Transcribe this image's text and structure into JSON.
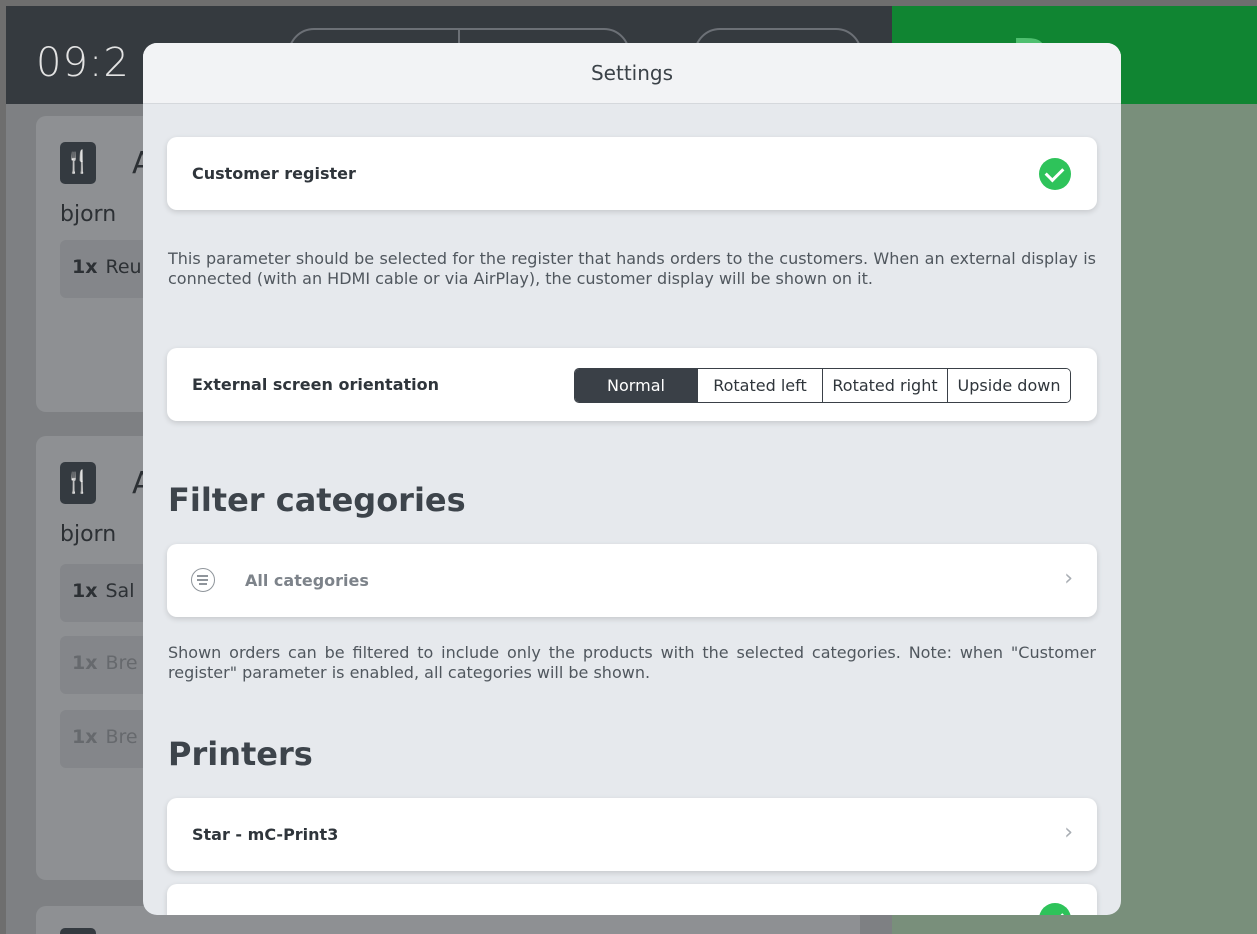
{
  "background": {
    "clock": "09:2",
    "done_label": "D",
    "orders": [
      {
        "letter": "A",
        "who": "bjorn",
        "lines": [
          {
            "qty": "1x",
            "name": "Reu"
          }
        ]
      },
      {
        "letter": "A",
        "who": "bjorn",
        "lines": [
          {
            "qty": "1x",
            "name": "Sal"
          },
          {
            "qty": "1x",
            "name": "Bre"
          },
          {
            "qty": "1x",
            "name": "Bre"
          }
        ]
      }
    ]
  },
  "modal": {
    "title": "Settings",
    "customer_register": {
      "label": "Customer register",
      "checked": true,
      "description": "This parameter should be selected for the register that hands orders to the customers. When an external display is connected (with an HDMI cable or via AirPlay), the customer display will be shown on it."
    },
    "orientation": {
      "label": "External screen orientation",
      "options": [
        "Normal",
        "Rotated left",
        "Rotated right",
        "Upside down"
      ],
      "selected": "Normal"
    },
    "filter": {
      "heading": "Filter categories",
      "row_label": "All categories",
      "description": "Shown orders can be filtered to include only the products with the selected categories. Note: when \"Customer register\" parameter is enabled, all categories will be shown."
    },
    "printers": {
      "heading": "Printers",
      "items": [
        {
          "label": "Star - mC-Print3"
        }
      ]
    }
  },
  "colors": {
    "accent_green": "#2ec35a",
    "done_green": "#108532",
    "dark": "#3a4047"
  }
}
